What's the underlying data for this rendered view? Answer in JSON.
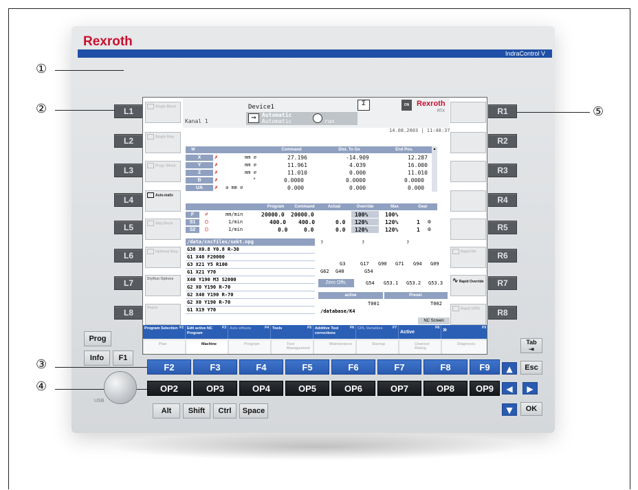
{
  "brand": "Rexroth",
  "product": "IndraControl V",
  "callouts": [
    "①",
    "②",
    "③",
    "④",
    "⑤"
  ],
  "left_keys": [
    "L1",
    "L2",
    "L3",
    "L4",
    "L5",
    "L6",
    "L7",
    "L8"
  ],
  "right_keys": [
    "R1",
    "R2",
    "R3",
    "R4",
    "R5",
    "R6",
    "R7",
    "R8"
  ],
  "left_soft": [
    "Single Block",
    "Single Step",
    "Progr. Block",
    "Auto-matic",
    "Skip Block",
    "Optional Stop",
    "DryRun Options",
    "Repos"
  ],
  "right_soft": [
    "",
    "",
    "",
    "",
    "",
    "Rapid 5%",
    "Rapid Override",
    "Rapid 100%"
  ],
  "header": {
    "device": "Device1",
    "channel": "Kanal 1",
    "mode": "Automatic",
    "mode_sub": "Automatic",
    "state": "run",
    "brand": "Rexroth",
    "brand_sub": "MTX",
    "datetime": "14.08.2003 | 11:48:37",
    "on_label": "ON"
  },
  "axes": {
    "headers": [
      "W",
      "Command",
      "Dist. To Go",
      "End Pos."
    ],
    "rows": [
      {
        "name": "X",
        "unit": "mm ⌀",
        "command": "27.196",
        "dist": "-14.909",
        "end": "12.287"
      },
      {
        "name": "Y",
        "unit": "mm ⌀",
        "command": "11.961",
        "dist": "4.039",
        "end": "16.000"
      },
      {
        "name": "Z",
        "unit": "mm ⌀",
        "command": "11.010",
        "dist": "0.000",
        "end": "11.010"
      },
      {
        "name": "B",
        "unit": "°",
        "command": "0.0000",
        "dist": "0.0000",
        "end": "0.0000"
      },
      {
        "name": "UA",
        "unit": "a   mm ⌀",
        "command": "0.000",
        "dist": "0.000",
        "end": "0.000"
      }
    ]
  },
  "spindles": {
    "headers": [
      "Program",
      "Command",
      "Actual",
      "Override",
      "Max",
      "Gear"
    ],
    "rows": [
      {
        "name": "F",
        "unit": "mm/min",
        "program": "20000.0",
        "command": "20000.0",
        "actual": "",
        "override": "100%",
        "max": "100%",
        "gear": ""
      },
      {
        "name": "S1",
        "unit": "1/min",
        "program": "400.0",
        "command": "400.0",
        "actual": "0.0",
        "override": "120%",
        "max": "120%",
        "gear": "1"
      },
      {
        "name": "S2",
        "unit": "1/min",
        "program": "0.0",
        "command": "0.0",
        "actual": "0.0",
        "override": "120%",
        "max": "120%",
        "gear": "1"
      }
    ]
  },
  "program": {
    "path": "/data/cncfiles/sekt.npg",
    "lines": [
      "G38 X0.8 Y0.8 R-30",
      "G1 X40 F20000",
      "G3 X21 Y5 R100",
      "G1 X21 Y70",
      "X40 Y190 M3 S2000",
      "G2 X0 Y190 R-70",
      "G2 X40 Y190 R-70",
      "G2 X0 Y190 R-70",
      "G1 X19 Y70"
    ]
  },
  "gcodes": {
    "q": "?",
    "row1": [
      "G3",
      "G17",
      "G90",
      "G71",
      "G94",
      "G09"
    ],
    "row2": [
      "G62",
      "G40",
      "G54"
    ],
    "zero_label": "Zero Offs.",
    "zero": [
      "G54",
      "G53.1",
      "G53.2",
      "G53.3"
    ],
    "active_label": "active",
    "presel_label": "Presel.",
    "tool_active": "T001",
    "tool_presel": "T002",
    "db": "/database/K4",
    "nc": "NC Screen"
  },
  "fbar": [
    {
      "label": "Program Selection",
      "key": "F2",
      "dim": false
    },
    {
      "label": "Edit active NC Program",
      "key": "F3",
      "dim": false
    },
    {
      "label": "Axis offsets",
      "key": "F4",
      "dim": true
    },
    {
      "label": "Tools",
      "key": "F5",
      "dim": false
    },
    {
      "label": "Additive Tool corrections",
      "key": "F6",
      "dim": false
    },
    {
      "label": "CPL Variables",
      "key": "F7",
      "dim": true
    },
    {
      "label": "Active",
      "key": "F8",
      "dim": false
    },
    {
      "label": "»",
      "key": "F9",
      "dim": false
    }
  ],
  "tabs": [
    {
      "label": "Plan",
      "on": false
    },
    {
      "label": "Machine",
      "on": true
    },
    {
      "label": "Program",
      "on": false
    },
    {
      "label": "Tool Management",
      "on": false
    },
    {
      "label": "Maintenance",
      "on": false
    },
    {
      "label": "Startup",
      "on": false
    },
    {
      "label": "Channel Dialog",
      "on": false
    },
    {
      "label": "Diagnosis",
      "on": false
    }
  ],
  "fkeys": [
    "F2",
    "F3",
    "F4",
    "F5",
    "F6",
    "F7",
    "F8",
    "F9"
  ],
  "opkeys": [
    "OP2",
    "OP3",
    "OP4",
    "OP5",
    "OP6",
    "OP7",
    "OP8",
    "OP9"
  ],
  "misc": {
    "prog": "Prog",
    "info": "Info",
    "f1": "F1",
    "tab": "Tab",
    "esc": "Esc",
    "ok": "OK",
    "usb": "USB",
    "alt": "Alt",
    "shift": "Shift",
    "ctrl": "Ctrl",
    "space": "Space",
    "up": "▲",
    "down": "▼",
    "left": "◀",
    "right": "▶"
  }
}
